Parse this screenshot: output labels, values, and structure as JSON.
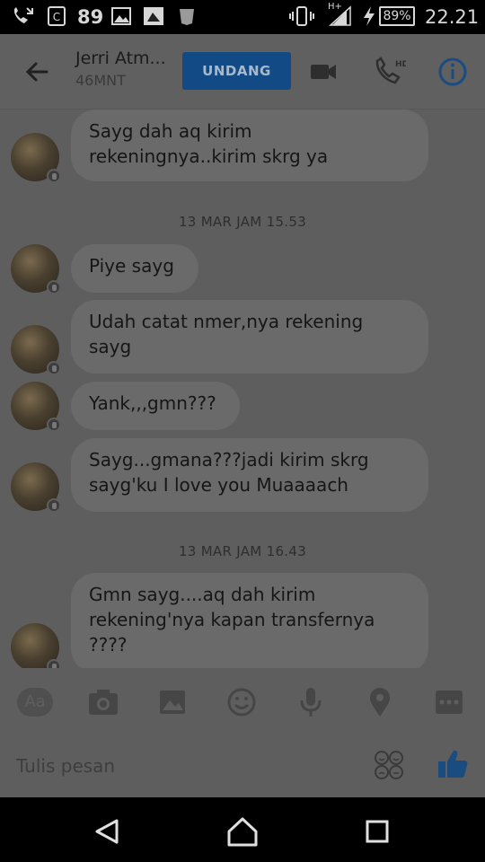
{
  "status_bar": {
    "notification_count": "89",
    "network_label": "H+",
    "battery": "89%",
    "time": "22.21"
  },
  "header": {
    "contact_name": "Jerri Atm...",
    "contact_status": "46MNT",
    "invite_label": "UNDANG"
  },
  "messages": [
    {
      "type": "bubble",
      "text": "Sayg dah aq kirim rekeningnya..kirim skrg ya"
    },
    {
      "type": "timestamp",
      "text": "13 MAR JAM 15.53"
    },
    {
      "type": "bubble",
      "text": "Piye sayg"
    },
    {
      "type": "bubble",
      "text": "Udah catat nmer,nya rekening sayg"
    },
    {
      "type": "bubble",
      "text": "Yank,,,gmn???"
    },
    {
      "type": "bubble",
      "text": "Sayg...gmana???jadi kirim skrg sayg'ku I love you Muaaaach"
    },
    {
      "type": "timestamp",
      "text": "13 MAR JAM 16.43"
    },
    {
      "type": "bubble",
      "text": "Gmn sayg....aq dah kirim rekening'nya kapan transfernya ????"
    }
  ],
  "toolbar": {
    "text_format_label": "Aa"
  },
  "compose": {
    "placeholder": "Tulis pesan"
  }
}
